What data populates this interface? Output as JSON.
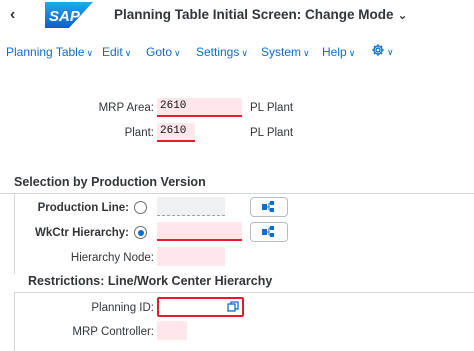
{
  "header": {
    "back_icon": "chevron-left-icon",
    "logo_text": "SAP",
    "title": "Planning Table Initial Screen: Change Mode",
    "title_chevron": "chevron-down-icon"
  },
  "menu": {
    "items": [
      {
        "label": "Planning Table"
      },
      {
        "label": "Edit"
      },
      {
        "label": "Goto"
      },
      {
        "label": "Settings"
      },
      {
        "label": "System"
      },
      {
        "label": "Help"
      }
    ],
    "settings_icon": "gear-icon"
  },
  "form": {
    "mrp_area": {
      "label": "MRP Area:",
      "value": "2610",
      "description": "PL Plant"
    },
    "plant": {
      "label": "Plant:",
      "value": "2610",
      "description": "PL Plant"
    }
  },
  "section_production_version": {
    "title": "Selection by Production Version",
    "production_line": {
      "label": "Production Line:",
      "value": "",
      "selected": false
    },
    "wkctr_hierarchy": {
      "label": "WkCtr Hierarchy:",
      "value": "",
      "selected": true
    },
    "hierarchy_node": {
      "label": "Hierarchy Node:",
      "value": ""
    },
    "button_icon": "hierarchy-icon"
  },
  "section_restrictions": {
    "title": "Restrictions: Line/Work Center Hierarchy",
    "planning_id": {
      "label": "Planning ID:",
      "value": "",
      "value_help_icon": "value-help-icon"
    },
    "mrp_controller": {
      "label": "MRP Controller:",
      "value": ""
    }
  },
  "colors": {
    "brand_blue": "#0a6ed1",
    "required_red": "#e61e2b",
    "field_pink": "#ffe6ea"
  }
}
